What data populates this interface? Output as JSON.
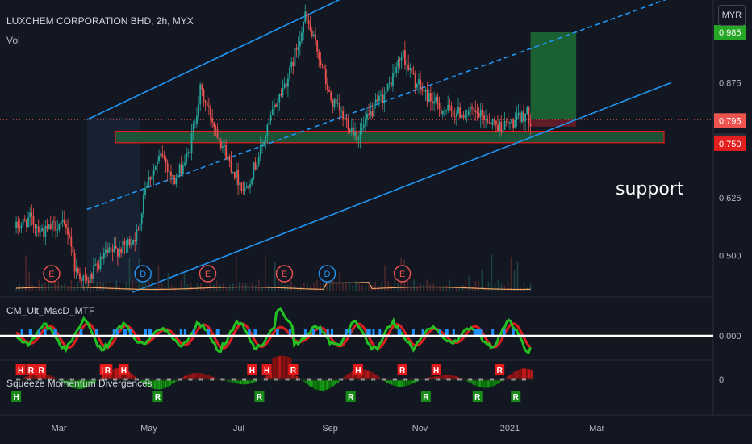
{
  "header": {
    "symbol_title": "LUXCHEM CORPORATION BHD, 2h, MYX",
    "volume_label": "Vol",
    "currency": "MYR"
  },
  "annotations": {
    "support_text": "support"
  },
  "indicators": {
    "macd_name": "CM_Ult_MacD_MTF",
    "macd_zero": "0.000",
    "squeeze_name": "Squeeze Momentum Divergences",
    "squeeze_zero": "0"
  },
  "colors": {
    "background": "#131722",
    "up": "#26a69a",
    "down": "#ef5350",
    "channel": "#2196f3",
    "support_fill": "#1e5a3a",
    "support_border": "#ff1a1a",
    "take_profit": "#1e7a3a",
    "stop_loss": "#7a1e2a",
    "macd_green": "#22c022",
    "macd_red": "#e02020",
    "macd_blue": "#1e90ff",
    "volume_line": "#f4a460"
  },
  "chart_data": {
    "type": "candlestick",
    "symbol": "LUXCHEM CORPORATION BHD",
    "interval": "2h",
    "exchange": "MYX",
    "currency": "MYR",
    "x_axis_ticks": [
      "Mar",
      "May",
      "Jul",
      "Sep",
      "Nov",
      "2021",
      "Mar"
    ],
    "y_axis_ticks": [
      0.5,
      0.625,
      0.75,
      0.875
    ],
    "ylim": [
      0.42,
      1.05
    ],
    "price_markers": [
      {
        "label": "0.985",
        "value": 0.985,
        "kind": "target"
      },
      {
        "label": "0.795",
        "value": 0.795,
        "kind": "last"
      },
      {
        "label": "0.795",
        "value": 0.795,
        "kind": "entry"
      },
      {
        "label": "0.750",
        "value": 0.75,
        "kind": "stop"
      }
    ],
    "price_path": [
      {
        "date": "2020-02-01",
        "price": 0.56
      },
      {
        "date": "2020-02-10",
        "price": 0.58
      },
      {
        "date": "2020-02-20",
        "price": 0.55
      },
      {
        "date": "2020-03-01",
        "price": 0.57
      },
      {
        "date": "2020-03-08",
        "price": 0.55
      },
      {
        "date": "2020-03-12",
        "price": 0.47
      },
      {
        "date": "2020-03-20",
        "price": 0.44
      },
      {
        "date": "2020-04-01",
        "price": 0.5
      },
      {
        "date": "2020-04-15",
        "price": 0.52
      },
      {
        "date": "2020-04-24",
        "price": 0.55
      },
      {
        "date": "2020-04-28",
        "price": 0.65
      },
      {
        "date": "2020-05-05",
        "price": 0.69
      },
      {
        "date": "2020-05-10",
        "price": 0.72
      },
      {
        "date": "2020-05-18",
        "price": 0.66
      },
      {
        "date": "2020-05-28",
        "price": 0.72
      },
      {
        "date": "2020-06-05",
        "price": 0.86
      },
      {
        "date": "2020-06-15",
        "price": 0.78
      },
      {
        "date": "2020-06-25",
        "price": 0.7
      },
      {
        "date": "2020-07-05",
        "price": 0.64
      },
      {
        "date": "2020-07-15",
        "price": 0.72
      },
      {
        "date": "2020-07-25",
        "price": 0.82
      },
      {
        "date": "2020-08-05",
        "price": 0.9
      },
      {
        "date": "2020-08-15",
        "price": 1.02
      },
      {
        "date": "2020-08-25",
        "price": 0.93
      },
      {
        "date": "2020-09-01",
        "price": 0.84
      },
      {
        "date": "2020-09-10",
        "price": 0.8
      },
      {
        "date": "2020-09-20",
        "price": 0.76
      },
      {
        "date": "2020-10-01",
        "price": 0.82
      },
      {
        "date": "2020-10-10",
        "price": 0.86
      },
      {
        "date": "2020-10-20",
        "price": 0.94
      },
      {
        "date": "2020-10-28",
        "price": 0.88
      },
      {
        "date": "2020-11-05",
        "price": 0.85
      },
      {
        "date": "2020-11-15",
        "price": 0.82
      },
      {
        "date": "2020-11-25",
        "price": 0.81
      },
      {
        "date": "2020-12-05",
        "price": 0.81
      },
      {
        "date": "2020-12-15",
        "price": 0.8
      },
      {
        "date": "2020-12-25",
        "price": 0.78
      },
      {
        "date": "2021-01-05",
        "price": 0.79
      },
      {
        "date": "2021-01-12",
        "price": 0.81
      },
      {
        "date": "2021-01-15",
        "price": 0.795
      }
    ],
    "support_zone": {
      "top": 0.77,
      "bottom": 0.745
    },
    "long_position": {
      "entry": 0.795,
      "target": 0.985,
      "stop": 0.75,
      "start": "2021-01-15",
      "end": "2021-02-15"
    },
    "channel_lines": [
      {
        "style": "solid",
        "points": [
          {
            "date": "2020-03-20",
            "price": 0.795
          },
          {
            "date": "2020-09-10",
            "price": 1.06
          }
        ]
      },
      {
        "style": "dashed",
        "points": [
          {
            "date": "2020-03-20",
            "price": 0.6
          },
          {
            "date": "2021-04-20",
            "price": 1.06
          }
        ]
      },
      {
        "style": "solid",
        "points": [
          {
            "date": "2020-04-20",
            "price": 0.42
          },
          {
            "date": "2021-04-20",
            "price": 0.875
          }
        ]
      }
    ],
    "event_markers": [
      {
        "label": "E",
        "date": "2020-02-25",
        "kind": "earnings"
      },
      {
        "label": "D",
        "date": "2020-04-27",
        "kind": "dividend"
      },
      {
        "label": "E",
        "date": "2020-06-10",
        "kind": "earnings"
      },
      {
        "label": "E",
        "date": "2020-08-01",
        "kind": "earnings"
      },
      {
        "label": "D",
        "date": "2020-08-30",
        "kind": "dividend"
      },
      {
        "label": "E",
        "date": "2020-10-20",
        "kind": "earnings"
      }
    ],
    "squeeze_signals": [
      {
        "label": "H",
        "date": "2020-02-01",
        "side": "bottom"
      },
      {
        "label": "H",
        "date": "2020-02-04",
        "side": "top"
      },
      {
        "label": "R",
        "date": "2020-02-11",
        "side": "top"
      },
      {
        "label": "R",
        "date": "2020-02-18",
        "side": "top"
      },
      {
        "label": "H",
        "date": "2020-04-01",
        "side": "top"
      },
      {
        "label": "R",
        "date": "2020-04-03",
        "side": "top"
      },
      {
        "label": "H",
        "date": "2020-04-14",
        "side": "top"
      },
      {
        "label": "R",
        "date": "2020-05-07",
        "side": "bottom"
      },
      {
        "label": "H",
        "date": "2020-07-10",
        "side": "top"
      },
      {
        "label": "H",
        "date": "2020-07-20",
        "side": "top"
      },
      {
        "label": "R",
        "date": "2020-07-15",
        "side": "bottom"
      },
      {
        "label": "R",
        "date": "2020-08-07",
        "side": "top"
      },
      {
        "label": "R",
        "date": "2020-09-15",
        "side": "bottom"
      },
      {
        "label": "H",
        "date": "2020-09-20",
        "side": "top"
      },
      {
        "label": "R",
        "date": "2020-10-20",
        "side": "top"
      },
      {
        "label": "R",
        "date": "2020-11-05",
        "side": "bottom"
      },
      {
        "label": "H",
        "date": "2020-11-12",
        "side": "top"
      },
      {
        "label": "R",
        "date": "2020-12-10",
        "side": "bottom"
      },
      {
        "label": "R",
        "date": "2020-12-25",
        "side": "top"
      },
      {
        "label": "R",
        "date": "2021-01-05",
        "side": "bottom"
      }
    ]
  }
}
